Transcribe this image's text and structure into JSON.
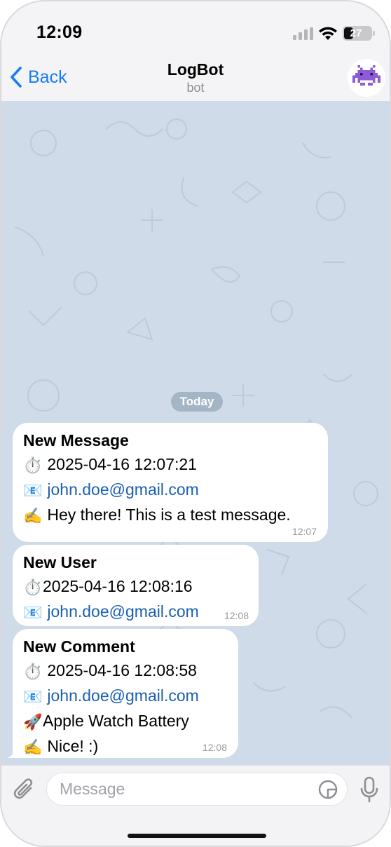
{
  "status_bar": {
    "time": "12:09",
    "battery": "27"
  },
  "nav": {
    "back_label": "Back",
    "title": "LogBot",
    "subtitle": "bot",
    "avatar_icon": "alien-monster-icon"
  },
  "chat": {
    "date_label": "Today",
    "messages": [
      {
        "title": "New Message",
        "lines": [
          {
            "icon": "⏱️",
            "text": "2025-04-16 12:07:21"
          },
          {
            "icon": "📧",
            "text": "john.doe@gmail.com",
            "link": true
          },
          {
            "icon": "✍️",
            "text": "Hey there! This is a test message."
          }
        ],
        "time": "12:07"
      },
      {
        "title": "New User",
        "lines": [
          {
            "icon": "⏱️",
            "text": "2025-04-16 12:08:16"
          },
          {
            "icon": "📧",
            "text": "john.doe@gmail.com",
            "link": true
          }
        ],
        "time": "12:08"
      },
      {
        "title": "New Comment",
        "lines": [
          {
            "icon": "⏱️",
            "text": "2025-04-16 12:08:58"
          },
          {
            "icon": "📧",
            "text": "john.doe@gmail.com",
            "link": true
          },
          {
            "icon": "🚀",
            "text": "Apple Watch Battery"
          },
          {
            "icon": "✍️",
            "text": "Nice! :)"
          }
        ],
        "time": "12:08"
      }
    ]
  },
  "composer": {
    "placeholder": "Message"
  },
  "colors": {
    "accent": "#1a7cf5",
    "chat_background": "#cfdbe8",
    "bubble": "#ffffff",
    "link": "#1a5fb4"
  }
}
